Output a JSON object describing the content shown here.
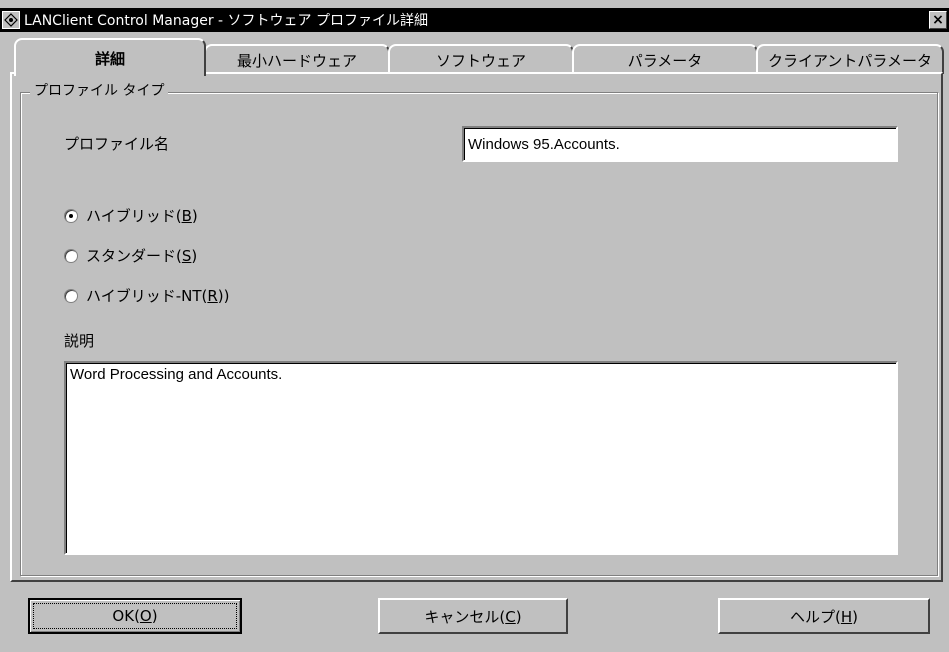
{
  "window": {
    "title": "LANClient Control Manager - ソフトウェア プロファイル詳細",
    "close_label": "×"
  },
  "tabs": [
    {
      "label": "詳細",
      "active": true
    },
    {
      "label": "最小ハードウェア",
      "active": false
    },
    {
      "label": "ソフトウェア",
      "active": false
    },
    {
      "label": "パラメータ",
      "active": false
    },
    {
      "label": "クライアントパラメータ",
      "active": false
    }
  ],
  "group": {
    "title": "プロファイル タイプ"
  },
  "profile_name": {
    "label": "プロファイル名",
    "value": "Windows 95.Accounts."
  },
  "radios": [
    {
      "text": "ハイブリッド",
      "mnemonic": "B",
      "checked": true
    },
    {
      "text": "スタンダード",
      "mnemonic": "S",
      "checked": false
    },
    {
      "text": "ハイブリッド-NT",
      "mnemonic": "R",
      "checked": false
    }
  ],
  "description": {
    "label": "説明",
    "value": "Word Processing and Accounts."
  },
  "buttons": {
    "ok": {
      "text": "OK",
      "mnemonic": "O"
    },
    "cancel": {
      "text": "キャンセル",
      "mnemonic": "C"
    },
    "help": {
      "text": "ヘルプ",
      "mnemonic": "H"
    }
  }
}
